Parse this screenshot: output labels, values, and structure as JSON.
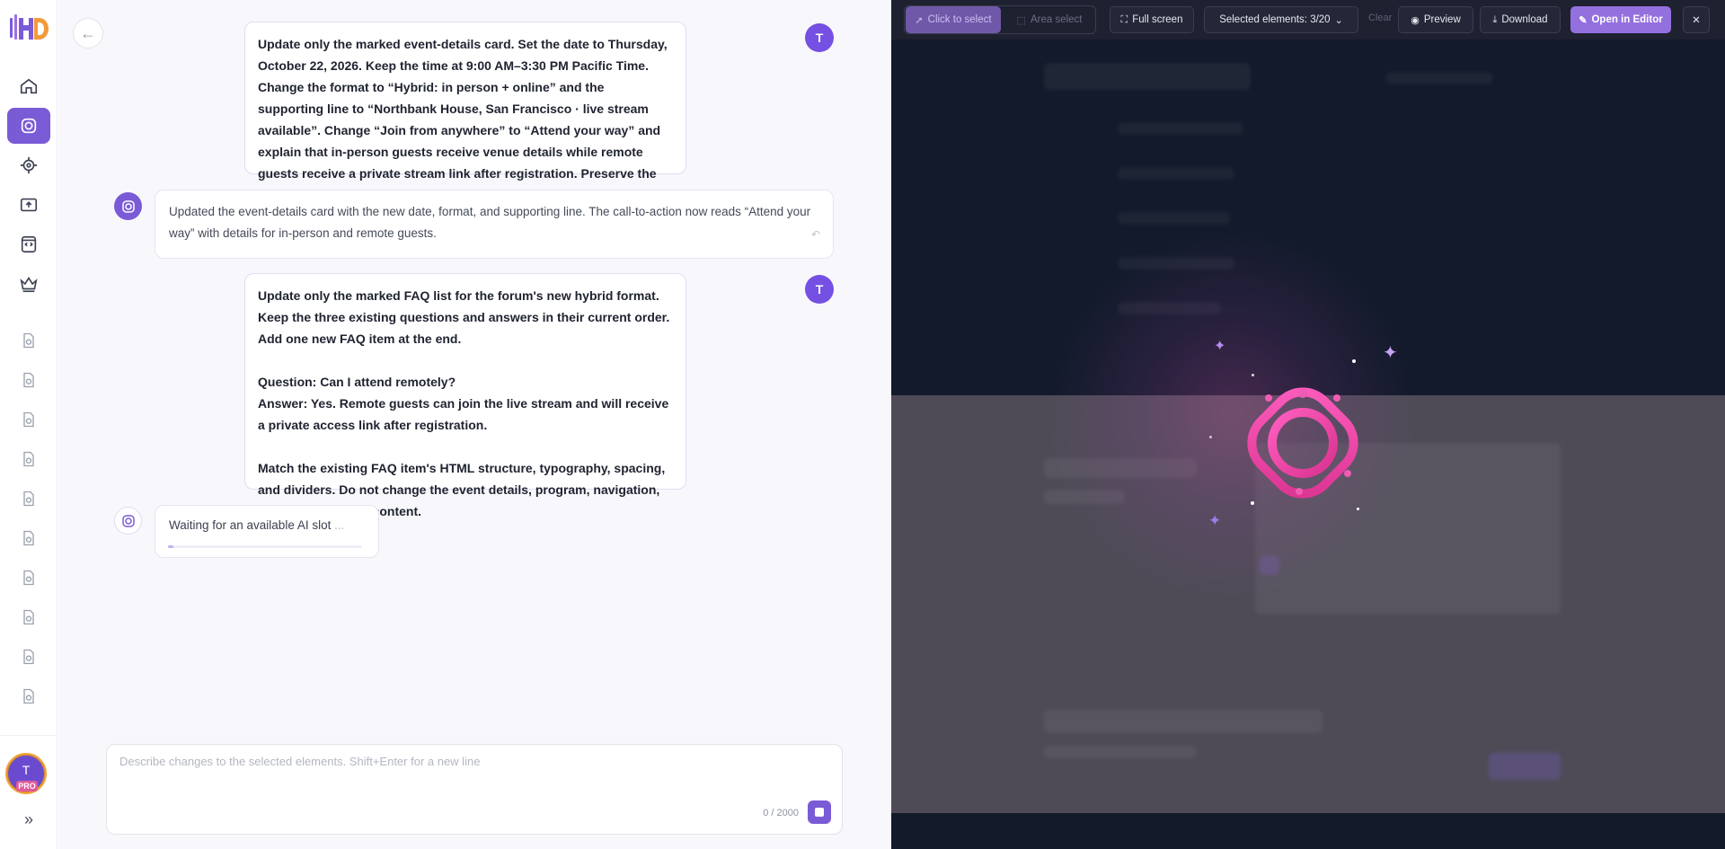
{
  "chat": {
    "messages": [
      {
        "role": "user",
        "avatar": "T",
        "text": "Update only the marked event-details card. Set the date to Thursday, October 22, 2026. Keep the time at 9:00 AM–3:30 PM Pacific Time. Change the format to “Hybrid: in person + online” and the supporting line to “Northbank House, San Francisco · live stream available”. Change “Join from anywhere” to “Attend your way” and explain that in-person guests receive venue details while remote guests receive a private stream link after registration. Preserve the card layout, typography, colors, and all unmarked sections."
      },
      {
        "role": "assistant",
        "text": "Updated the event-details card with the new date, format, and supporting line. The call-to-action now reads “Attend your way” with details for in-person and remote guests."
      },
      {
        "role": "user",
        "avatar": "T",
        "text": "Update only the marked FAQ list for the forum's new hybrid format. Keep the three existing questions and answers in their current order. Add one new FAQ item at the end.\n\nQuestion: Can I attend remotely?\nAnswer: Yes. Remote guests can join the live stream and will receive a private access link after registration.\n\nMatch the existing FAQ item's HTML structure, typography, spacing, and dividers. Do not change the event details, program, navigation, or other unmarked content."
      },
      {
        "role": "assistant",
        "status": "Waiting for an available AI slot",
        "ellipsis": "...",
        "progress": 0.03
      }
    ]
  },
  "composer": {
    "placeholder": "Describe changes to the selected elements. Shift+Enter for a new line",
    "char_count": "0 / 2000"
  },
  "sidebar": {
    "user_initial": "T",
    "badge": "PRO",
    "expand_icon": "»",
    "nav": [
      "home-icon",
      "ai-chip-icon",
      "target-icon",
      "upload-icon",
      "code-file-icon",
      "crown-icon"
    ],
    "history_count": 10
  },
  "toolbar": {
    "click_select": "Click to select",
    "area_select": "Area select",
    "full_screen": "Full screen",
    "selected": "Selected elements: 3/20",
    "clear": "Clear",
    "preview": "Preview",
    "download": "Download",
    "open_editor": "Open in Editor"
  },
  "colors": {
    "accent": "#7a5bd6",
    "user_avatar": "#7550e3",
    "glow": "#e04aa8"
  }
}
